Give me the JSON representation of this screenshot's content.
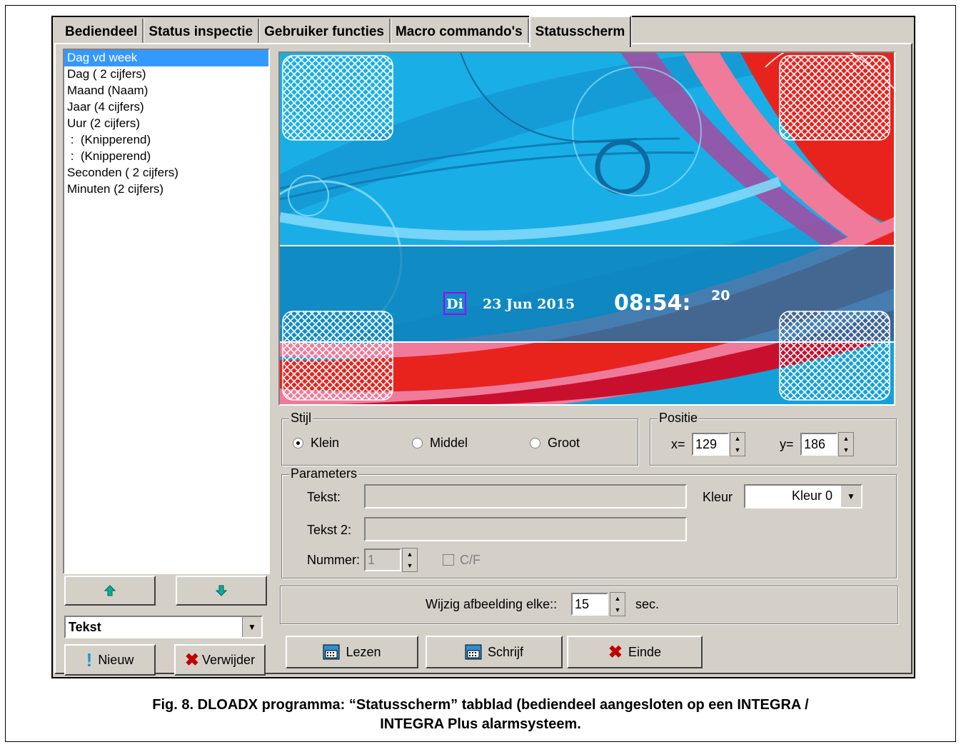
{
  "tabs": [
    "Bediendeel",
    "Status inspectie",
    "Gebruiker functies",
    "Macro commando's",
    "Statusscherm"
  ],
  "active_tab": "Statusscherm",
  "list_items": [
    "Dag vd week",
    "Dag ( 2 cijfers)",
    "Maand (Naam)",
    "Jaar (4 cijfers)",
    "Uur (2 cijfers)",
    " :  (Knipperend)",
    " :  (Knipperend)",
    "Seconden ( 2 cijfers)",
    "Minuten (2 cijfers)"
  ],
  "selected_item": "Dag vd week",
  "type_combo": "Tekst",
  "buttons": {
    "nieuw": "Nieuw",
    "verwijder": "Verwijder",
    "lezen": "Lezen",
    "schrijf": "Schrijf",
    "einde": "Einde"
  },
  "preview": {
    "day": "Di",
    "date": "23 Jun 2015",
    "time": "08:54:",
    "seconds": "20"
  },
  "stijl": {
    "label": "Stijl",
    "options": [
      "Klein",
      "Middel",
      "Groot"
    ],
    "selected": "Klein"
  },
  "positie": {
    "label": "Positie",
    "x_label": "x=",
    "x": "129",
    "y_label": "y=",
    "y": "186"
  },
  "parameters": {
    "label": "Parameters",
    "tekst_label": "Tekst:",
    "tekst": "",
    "tekst2_label": "Tekst 2:",
    "tekst2": "",
    "kleur_label": "Kleur",
    "kleur": "Kleur 0",
    "nummer_label": "Nummer:",
    "nummer": "1",
    "cf_label": "C/F"
  },
  "wijzig": {
    "label": "Wijzig afbeelding elke::",
    "value": "15",
    "unit": "sec."
  },
  "caption_line1": "Fig. 8. DLOADX programma: “Statusscherm” tabblad (bediendeel aangesloten op een INTEGRA /",
  "caption_line2": "INTEGRA Plus alarmsysteem.",
  "colors": {
    "selection": "#3399ff",
    "preview_blue": "#1ab0e8",
    "preview_red": "#e8231e",
    "preview_pink": "#f07a9a"
  }
}
